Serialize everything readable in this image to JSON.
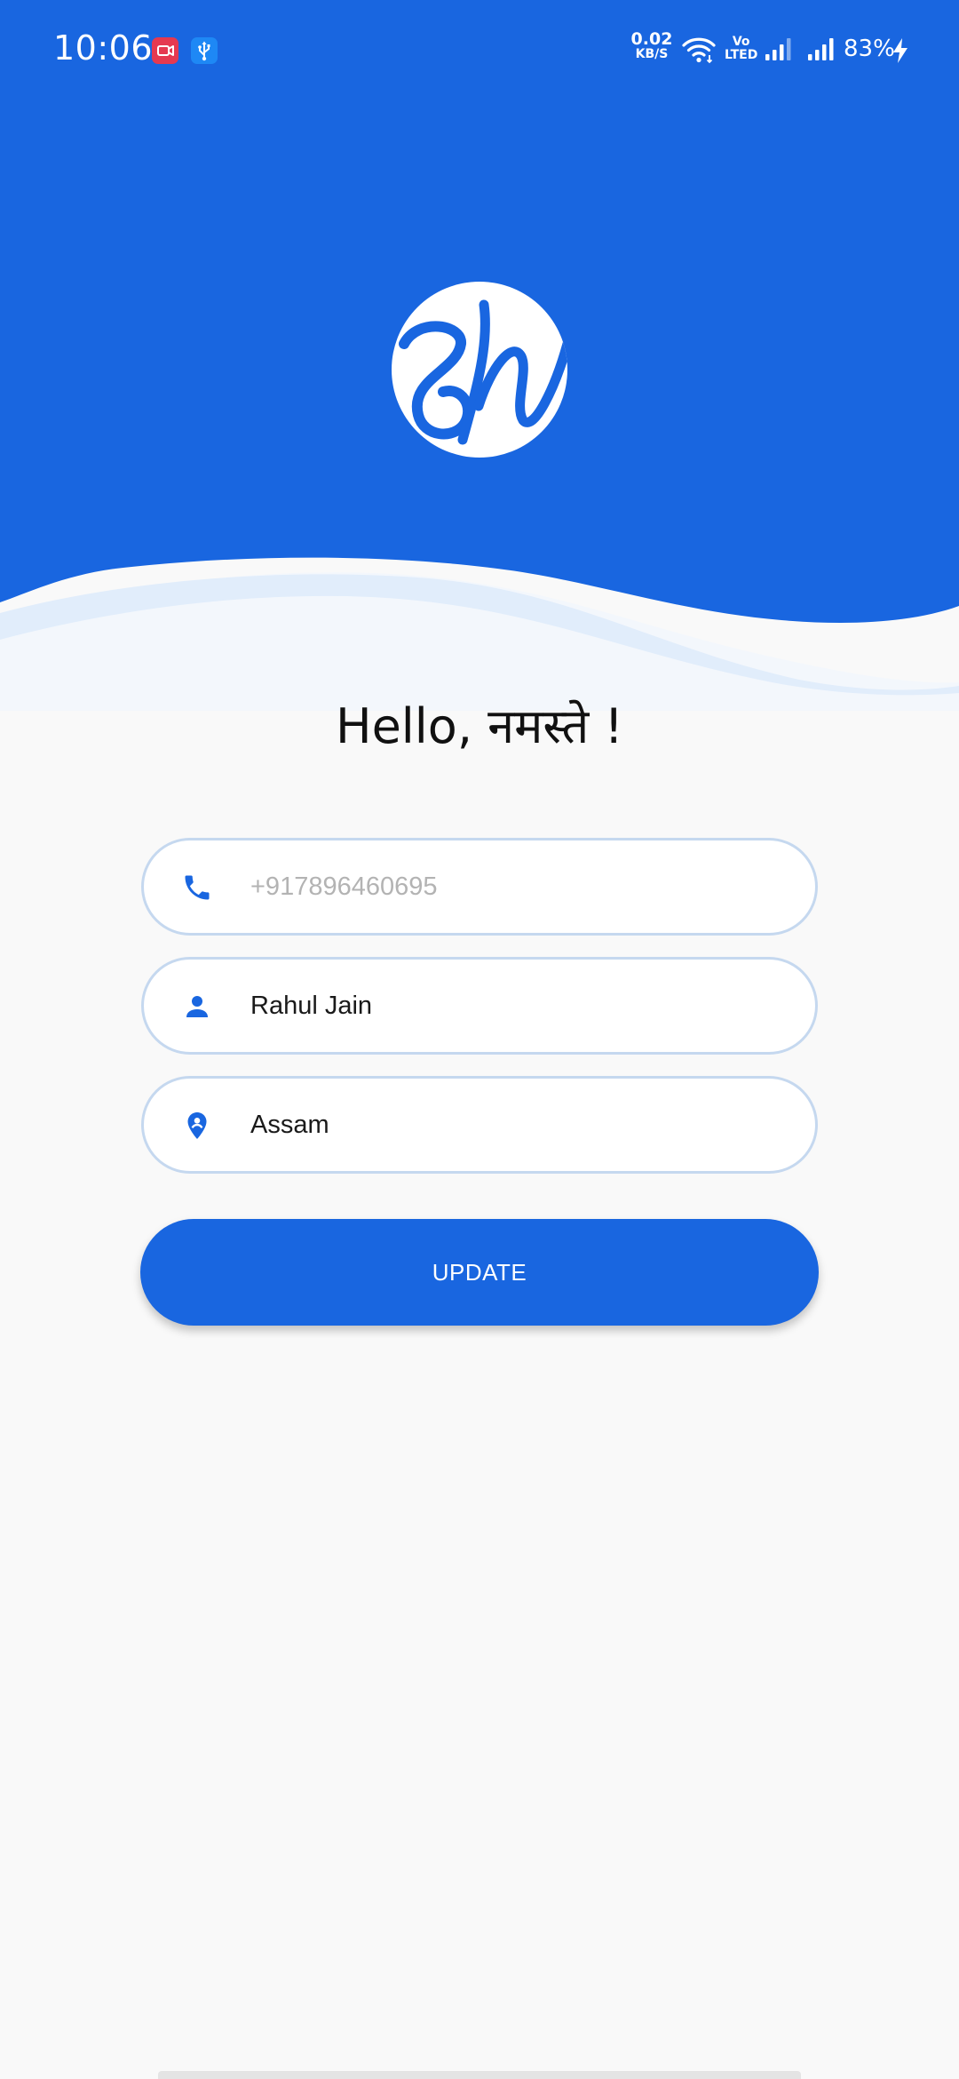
{
  "status_bar": {
    "time": "10:06",
    "net_speed_value": "0.02",
    "net_speed_unit": "KB/S",
    "volte_top": "Vo",
    "volte_bottom": "LTED",
    "battery": "83%",
    "icons": [
      "screen-recorder-icon",
      "usb-icon",
      "wifi-icon",
      "signal-icon",
      "signal-icon",
      "charging-icon"
    ]
  },
  "brand": {
    "logo": "sh-logo",
    "primary_color": "#1966e0"
  },
  "greeting": "Hello, नमस्ते !",
  "form": {
    "phone": {
      "icon": "phone-icon",
      "value": "",
      "placeholder": "+917896460695"
    },
    "name": {
      "icon": "person-icon",
      "value": "Rahul Jain",
      "placeholder": ""
    },
    "state": {
      "icon": "location-pin-icon",
      "value": "Assam",
      "placeholder": ""
    }
  },
  "update_button_label": "UPDATE"
}
